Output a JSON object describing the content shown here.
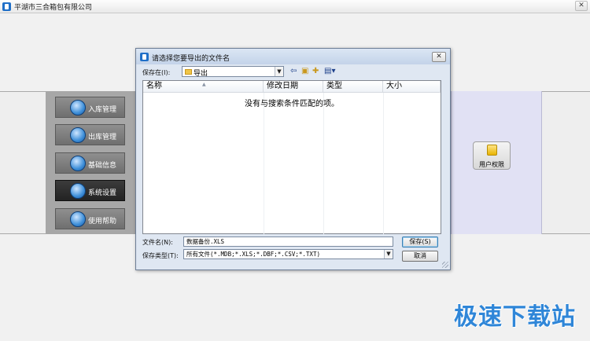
{
  "main_window": {
    "title": "平湖市三合箱包有限公司",
    "close_glyph": "✕"
  },
  "menu": [
    {
      "label": "入库管理",
      "icon": "inbound-icon",
      "active": false
    },
    {
      "label": "出库管理",
      "icon": "outbound-icon",
      "active": false
    },
    {
      "label": "基础信息",
      "icon": "info-icon",
      "active": false
    },
    {
      "label": "系统设置",
      "icon": "settings-icon",
      "active": true
    },
    {
      "label": "使用帮助",
      "icon": "help-icon",
      "active": false
    }
  ],
  "right_panel": {
    "user_permission_label": "用户权限"
  },
  "dialog": {
    "title": "请选择您要导出的文件名",
    "close_glyph": "✕",
    "save_in_label": "保存在(I):",
    "save_in_value": "导出",
    "columns": [
      "名称",
      "修改日期",
      "类型",
      "大小"
    ],
    "empty_message": "没有与搜索条件匹配的项。",
    "filename_label": "文件名(N):",
    "filename_value": "数据备份.XLS",
    "filetype_label": "保存类型(T):",
    "filetype_value": "所有文件(*.MDB;*.XLS;*.DBF;*.CSV;*.TXT)",
    "save_button": "保存(S)",
    "cancel_button": "取消"
  },
  "watermark": "极速下载站",
  "colors": {
    "menu_panel": "#a7a7a7",
    "menu_button": "#7f7f7f",
    "menu_active": "#2f2f2f",
    "right_panel": "#e1e1f4",
    "dialog_frame": "#dfe7f2",
    "watermark": "#2f86d8"
  }
}
